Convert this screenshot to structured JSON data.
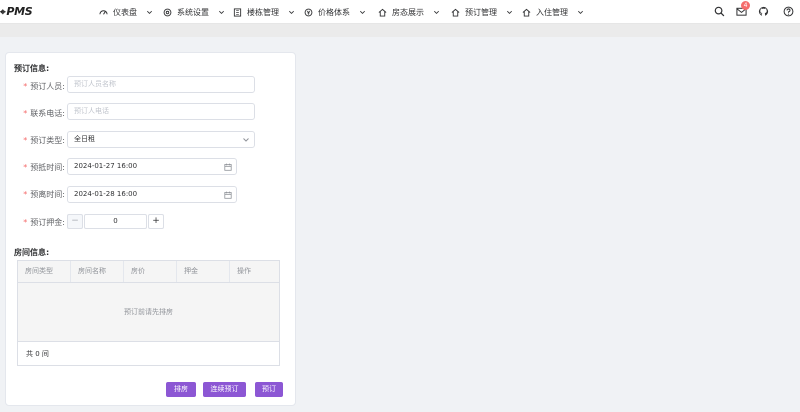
{
  "header": {
    "logo_mark": "⌖",
    "logo_text": "PMS",
    "nav": [
      {
        "label": "仪表盘",
        "icon": "dashboard-icon"
      },
      {
        "label": "系统设置",
        "icon": "settings-icon"
      },
      {
        "label": "楼栋管理",
        "icon": "building-icon"
      },
      {
        "label": "价格体系",
        "icon": "price-icon"
      },
      {
        "label": "房态展示",
        "icon": "house-icon"
      },
      {
        "label": "预订管理",
        "icon": "house-icon"
      },
      {
        "label": "入住管理",
        "icon": "house-icon"
      }
    ],
    "notification_count": "4",
    "right_icons": [
      "search-icon",
      "mail-icon",
      "github-icon",
      "help-icon"
    ]
  },
  "form": {
    "section_title": "预订信息:",
    "required_mark": "*",
    "booker": {
      "label": "预订人员:",
      "placeholder": "预订人员名称"
    },
    "phone": {
      "label": "联系电话:",
      "placeholder": "预订人电话"
    },
    "type": {
      "label": "预订类型:",
      "value": "全日租"
    },
    "arrive": {
      "label": "预抵时间:",
      "value": "2024-01-27 16:00"
    },
    "leave": {
      "label": "预离时间:",
      "value": "2024-01-28 16:00"
    },
    "deposit": {
      "label": "预订押金:",
      "value": "0",
      "minus": "−",
      "plus": "+"
    }
  },
  "rooms": {
    "section_title": "房间信息:",
    "columns": [
      "房间类型",
      "房间名称",
      "房价",
      "押金",
      "操作"
    ],
    "empty_text": "预订前请先排房",
    "total": "共 0 间"
  },
  "actions": {
    "arrange": "排房",
    "continue": "连续预订",
    "book": "预订"
  },
  "colors": {
    "primary": "#8c57d4",
    "required": "#f56c6c"
  }
}
